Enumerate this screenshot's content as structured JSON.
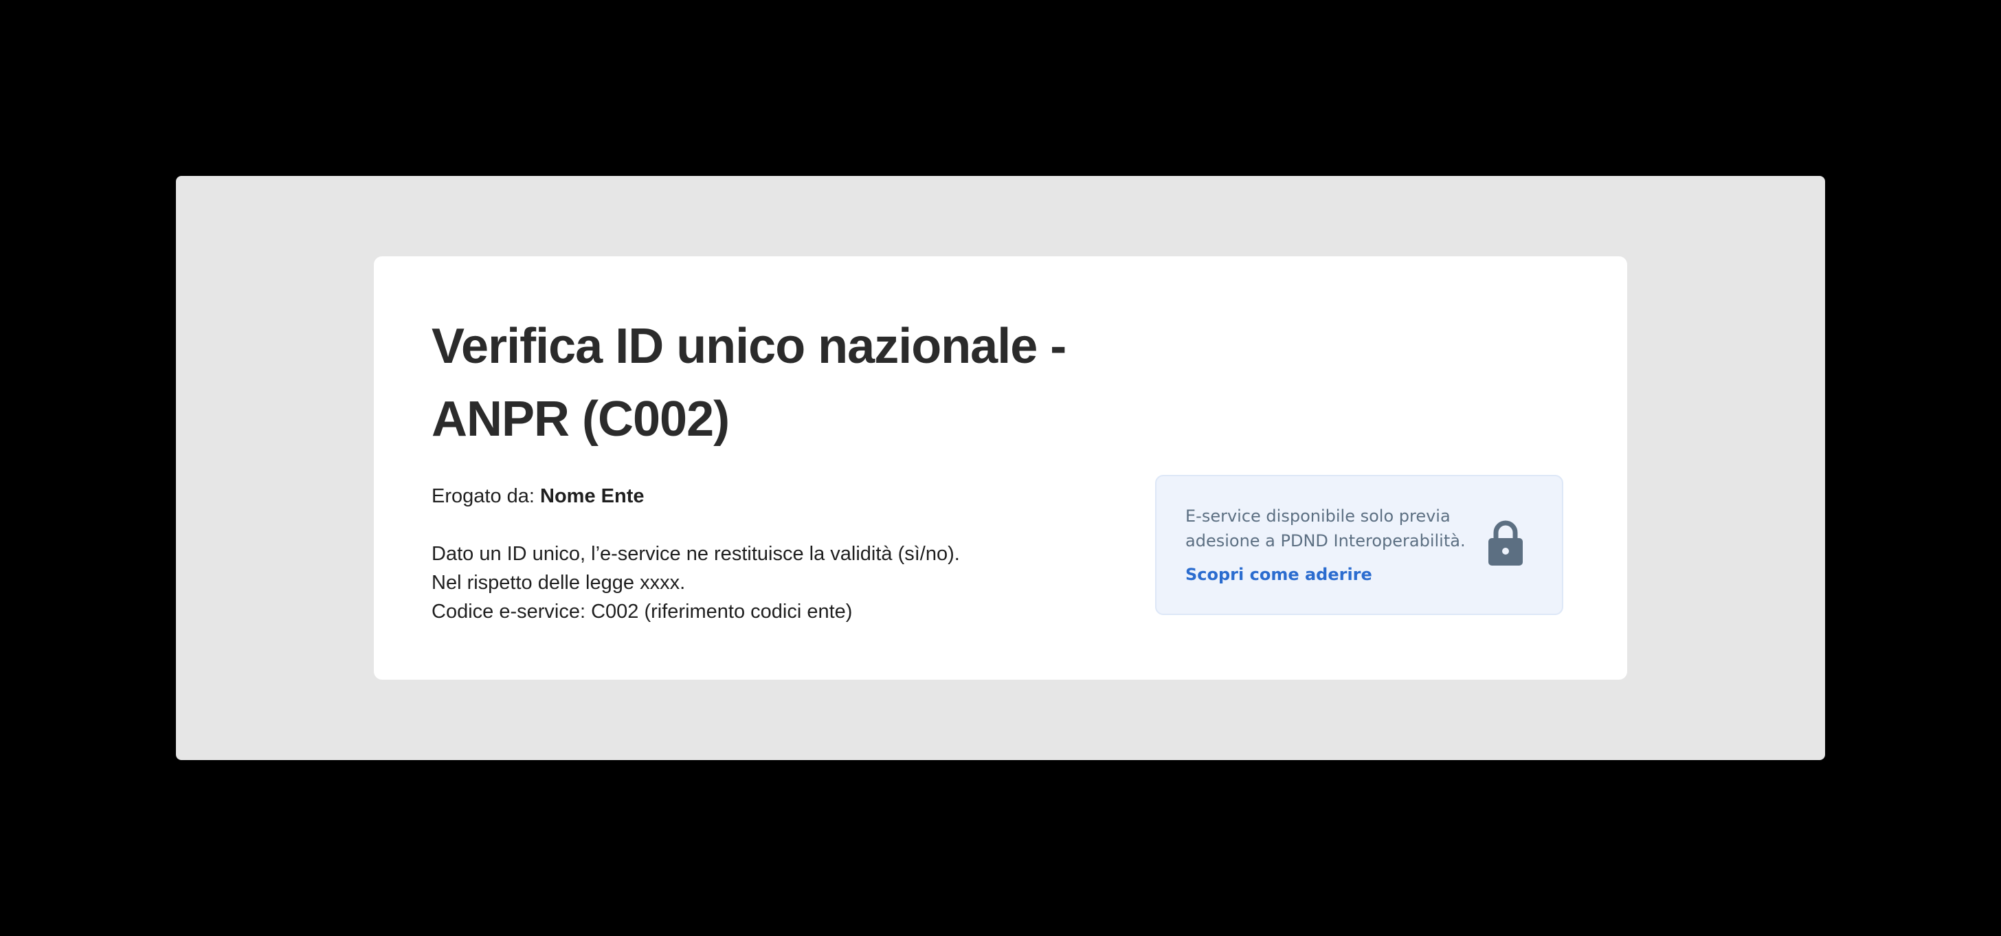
{
  "service": {
    "title": "Verifica ID unico nazionale - ANPR (C002)",
    "provider_label": "Erogato da:",
    "provider_name": "Nome Ente",
    "description_lines": [
      "Dato un ID unico, l’e-service ne restituisce la validità (sì/no).",
      "Nel rispetto delle legge xxxx.",
      "Codice e-service: C002 (riferimento codici ente)"
    ]
  },
  "notice": {
    "text": "E-service disponibile solo previa adesione a PDND Interoperabilità.",
    "link_label": "Scopri come aderire",
    "icon": "lock-icon"
  },
  "colors": {
    "page_background": "#000000",
    "frame_background": "#e6e6e6",
    "card_background": "#ffffff",
    "notice_background": "#eef3fc",
    "link_color": "#2b6ccf",
    "icon_color": "#5c6f82"
  }
}
